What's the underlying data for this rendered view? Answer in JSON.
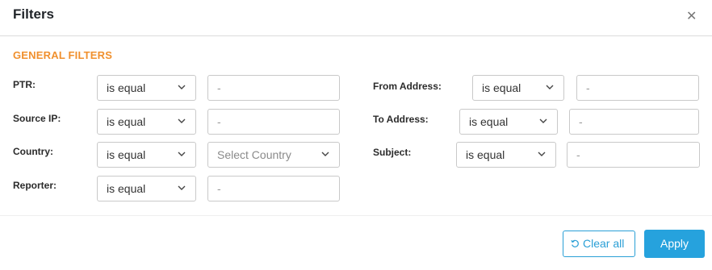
{
  "header": {
    "title": "Filters",
    "close_icon": "close-icon"
  },
  "section": {
    "title": "GENERAL FILTERS"
  },
  "filters": {
    "ptr": {
      "label": "PTR:",
      "operator": "is equal",
      "value": "-"
    },
    "source_ip": {
      "label": "Source IP:",
      "operator": "is equal",
      "value": "-"
    },
    "country": {
      "label": "Country:",
      "operator": "is equal",
      "placeholder": "Select Country"
    },
    "reporter": {
      "label": "Reporter:",
      "operator": "is equal",
      "value": "-"
    },
    "from_address": {
      "label": "From Address:",
      "operator": "is equal",
      "value": "-"
    },
    "to_address": {
      "label": "To Address:",
      "operator": "is equal",
      "value": "-"
    },
    "subject": {
      "label": "Subject:",
      "operator": "is equal",
      "value": "-"
    }
  },
  "footer": {
    "clear_label": "Clear all",
    "apply_label": "Apply"
  },
  "colors": {
    "accent": "#26a2dd",
    "section_title": "#f0902e"
  }
}
